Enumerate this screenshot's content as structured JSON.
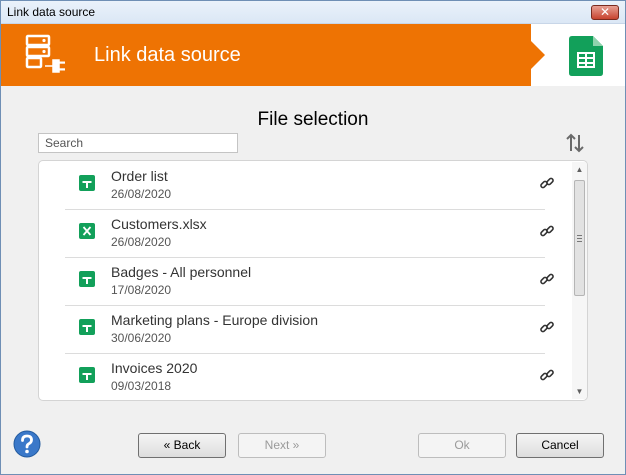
{
  "window": {
    "title": "Link data source",
    "close_label": "✕"
  },
  "header": {
    "title": "Link data source",
    "brand_color": "#ee7303"
  },
  "section": {
    "title": "File selection"
  },
  "search": {
    "placeholder": "Search"
  },
  "files": [
    {
      "name": "Order list",
      "date": "26/08/2020",
      "icon": "google-sheets-icon"
    },
    {
      "name": "Customers.xlsx",
      "date": "26/08/2020",
      "icon": "excel-icon"
    },
    {
      "name": "Badges - All personnel",
      "date": "17/08/2020",
      "icon": "google-sheets-icon"
    },
    {
      "name": "Marketing plans - Europe division",
      "date": "30/06/2020",
      "icon": "google-sheets-icon"
    },
    {
      "name": "Invoices 2020",
      "date": "09/03/2018",
      "icon": "google-sheets-icon"
    }
  ],
  "buttons": {
    "back": "« Back",
    "next": "Next »",
    "ok": "Ok",
    "cancel": "Cancel"
  }
}
